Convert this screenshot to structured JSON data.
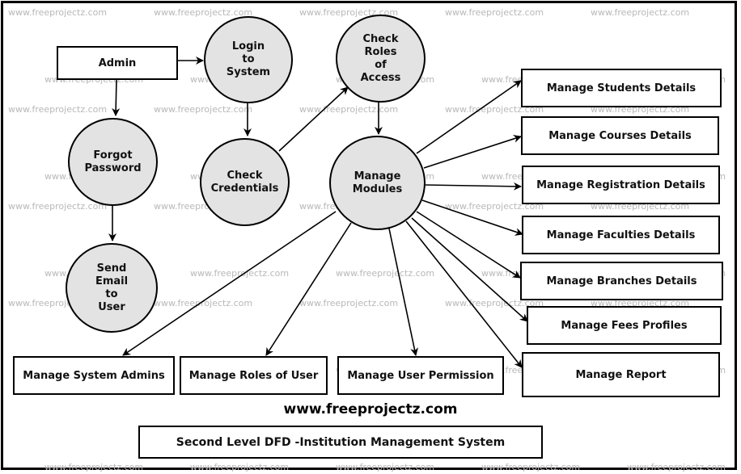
{
  "diagram": {
    "title": "Second Level DFD -Institution Management System",
    "website": "www.freeprojectz.com",
    "watermark": "www.freeprojectz.com",
    "colors": {
      "process_fill": "#e3e3e3",
      "stroke": "#000000",
      "watermark": "#b8b8b8"
    },
    "entities": {
      "admin": "Admin",
      "students": "Manage Students Details",
      "courses": "Manage Courses Details",
      "registration": "Manage Registration Details",
      "faculties": "Manage Faculties Details",
      "branches": "Manage Branches Details",
      "fees": "Manage Fees Profiles",
      "report": "Manage Report",
      "system_admins": "Manage System Admins",
      "roles_user": "Manage Roles of User",
      "user_permission": "Manage User Permission"
    },
    "processes": {
      "login": "Login\nto\nSystem",
      "check_roles": "Check\nRoles\nof\nAccess",
      "forgot_password": "Forgot\nPassword",
      "check_credentials": "Check\nCredentials",
      "manage_modules": "Manage\nModules",
      "send_email": "Send\nEmail\nto\nUser"
    },
    "flows": [
      {
        "from": "Admin",
        "to": "Login to System"
      },
      {
        "from": "Admin",
        "to": "Forgot Password"
      },
      {
        "from": "Forgot Password",
        "to": "Send Email to User"
      },
      {
        "from": "Login to System",
        "to": "Check Credentials"
      },
      {
        "from": "Check Credentials",
        "to": "Check Roles of Access"
      },
      {
        "from": "Check Roles of Access",
        "to": "Manage Modules"
      },
      {
        "from": "Manage Modules",
        "to": "Manage Students Details"
      },
      {
        "from": "Manage Modules",
        "to": "Manage Courses Details"
      },
      {
        "from": "Manage Modules",
        "to": "Manage Registration Details"
      },
      {
        "from": "Manage Modules",
        "to": "Manage Faculties Details"
      },
      {
        "from": "Manage Modules",
        "to": "Manage Branches Details"
      },
      {
        "from": "Manage Modules",
        "to": "Manage Fees Profiles"
      },
      {
        "from": "Manage Modules",
        "to": "Manage Report"
      },
      {
        "from": "Manage Modules",
        "to": "Manage System Admins"
      },
      {
        "from": "Manage Modules",
        "to": "Manage Roles of User"
      },
      {
        "from": "Manage Modules",
        "to": "Manage User Permission"
      }
    ]
  }
}
